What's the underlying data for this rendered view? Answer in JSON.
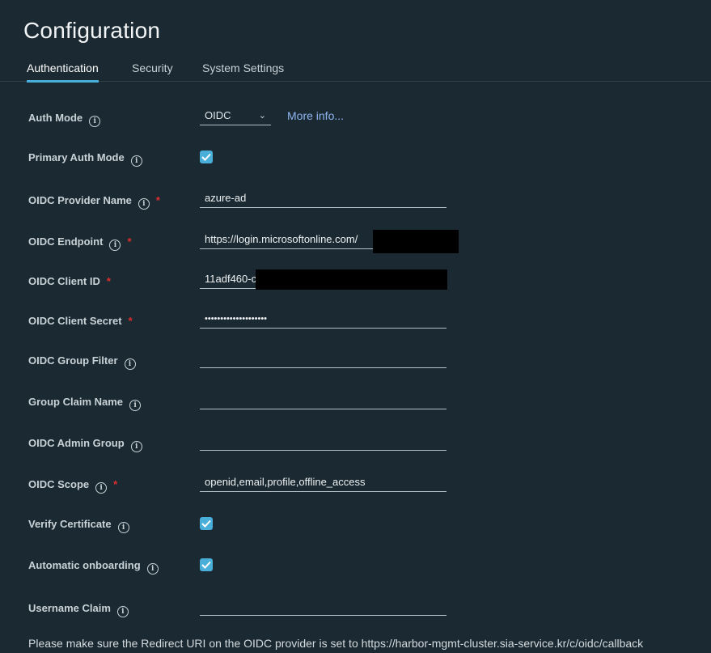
{
  "page": {
    "title": "Configuration"
  },
  "tabs": [
    {
      "label": "Authentication",
      "active": true
    },
    {
      "label": "Security"
    },
    {
      "label": "System Settings"
    }
  ],
  "fields": {
    "auth_mode": {
      "label": "Auth Mode",
      "value": "OIDC",
      "link": "More info..."
    },
    "primary_auth_mode": {
      "label": "Primary Auth Mode",
      "checked": true
    },
    "oidc_provider_name": {
      "label": "OIDC Provider Name",
      "value": "azure-ad",
      "required": true
    },
    "oidc_endpoint": {
      "label": "OIDC Endpoint",
      "value": "https://login.microsoftonline.com/",
      "required": true
    },
    "oidc_client_id": {
      "label": "OIDC Client ID",
      "value": "11adf460-c",
      "required": true
    },
    "oidc_client_secret": {
      "label": "OIDC Client Secret",
      "value": "••••••••••••••••••••",
      "required": true
    },
    "oidc_group_filter": {
      "label": "OIDC Group Filter",
      "value": ""
    },
    "group_claim_name": {
      "label": "Group Claim Name",
      "value": ""
    },
    "oidc_admin_group": {
      "label": "OIDC Admin Group",
      "value": ""
    },
    "oidc_scope": {
      "label": "OIDC Scope",
      "value": "openid,email,profile,offline_access",
      "required": true
    },
    "verify_certificate": {
      "label": "Verify Certificate",
      "checked": true
    },
    "automatic_onboarding": {
      "label": "Automatic onboarding",
      "checked": true
    },
    "username_claim": {
      "label": "Username Claim",
      "value": ""
    }
  },
  "footer_note": "Please make sure the Redirect URI on the OIDC provider is set to https://harbor-mgmt-cluster.sia-service.kr/c/oidc/callback",
  "colors": {
    "accent": "#49afd9",
    "background": "#1b2a32",
    "required": "#e02e2e",
    "link": "#8fb5f0"
  }
}
